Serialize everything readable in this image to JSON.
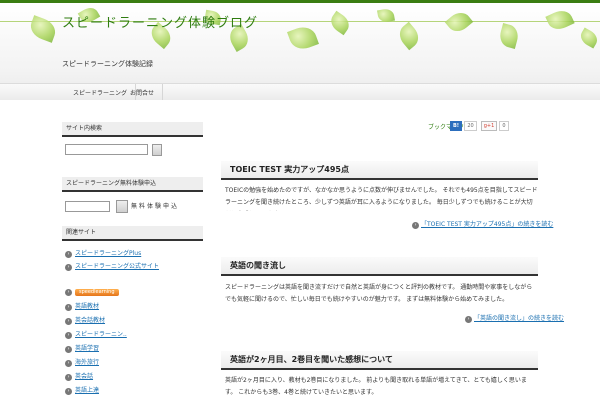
{
  "site": {
    "title": "スピードラーニング体験ブログ",
    "tagline": "スピードラーニング体験記録"
  },
  "nav": {
    "items": [
      "スピードラーニング",
      "お問合せ"
    ]
  },
  "sidebar": {
    "search": {
      "title": "サイト内検索"
    },
    "register": {
      "title": "スピードラーニング無料体験申込",
      "label": "無料体験申込"
    },
    "links": {
      "title": "関連サイト",
      "items": [
        "スピードラーニングPlus",
        "スピードラーニング公式サイト"
      ],
      "badge": "speedlearning",
      "menu": [
        "英語教材",
        "英会話教材",
        "スピードラーニン..",
        "英語学習",
        "海外旅行",
        "英会話",
        "英語上達"
      ]
    }
  },
  "share": {
    "label": "ブックマーク",
    "hatena": "B!",
    "hatena_count": "20",
    "gplus": "g+1",
    "gplus_count": "0"
  },
  "posts": [
    {
      "title": "TOEIC TEST 実力アップ495点",
      "body": "TOEICの勉強を始めたのですが、なかなか思うように点数が伸びませんでした。 それでも495点を目指してスピードラーニングを聞き続けたところ、少しずつ英語が耳に入るようになりました。 毎日少しずつでも続けることが大切だと実感しています。",
      "more": "「TOEIC TEST 実力アップ495点」の続きを読む"
    },
    {
      "title": "英語の聞き流し",
      "body": "スピードラーニングは英語を聞き流すだけで自然と英語が身につくと評判の教材です。 通勤時間や家事をしながらでも気軽に聞けるので、忙しい毎日でも続けやすいのが魅力です。 まずは無料体験から始めてみました。",
      "more": "「英語の聞き流し」の続きを読む"
    },
    {
      "title": "英語が2ヶ月目、2巻目を聞いた感想について",
      "body": "英語が2ヶ月目に入り、教材も2巻目になりました。 前よりも聞き取れる単語が増えてきて、とても嬉しく思います。 これからも3巻、4巻と続けていきたいと思います。",
      "more": ""
    }
  ],
  "colors": {
    "accent": "#2f7d10",
    "link": "#1a6fb0",
    "rule": "#333333"
  }
}
